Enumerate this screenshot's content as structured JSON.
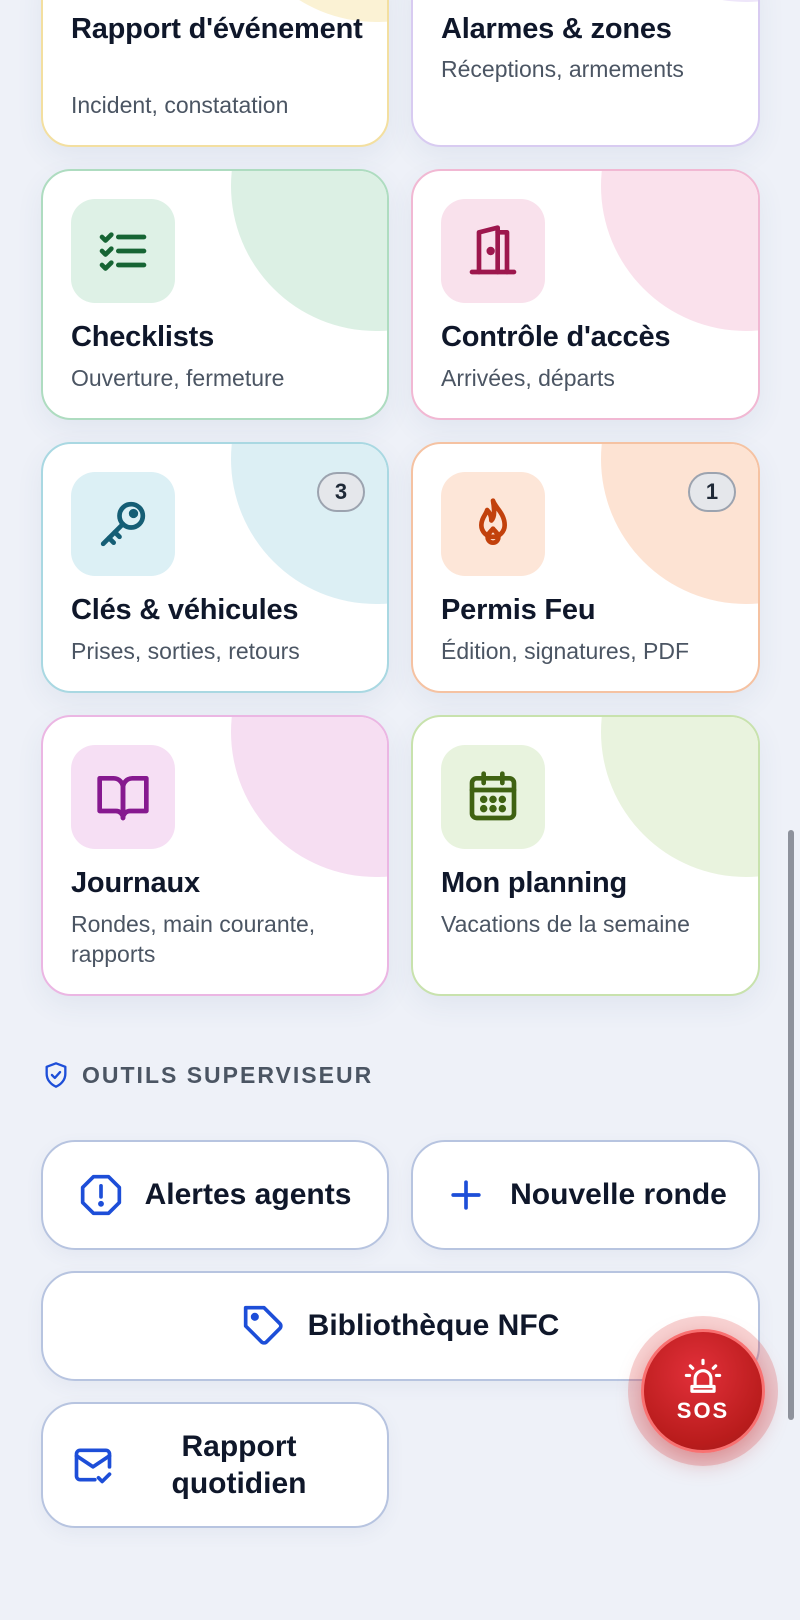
{
  "cards": {
    "rapport": {
      "title": "Rapport d'événement",
      "sub": "Incident, constatation"
    },
    "alarmes": {
      "title": "Alarmes & zones",
      "sub": "Réceptions, armements"
    },
    "checklists": {
      "title": "Checklists",
      "sub": "Ouverture, fermeture"
    },
    "controle": {
      "title": "Contrôle d'accès",
      "sub": "Arrivées, départs"
    },
    "cles": {
      "title": "Clés & véhicules",
      "sub": "Prises, sorties, retours",
      "badge": "3"
    },
    "permis": {
      "title": "Permis Feu",
      "sub": "Édition, signatures, PDF",
      "badge": "1"
    },
    "journaux": {
      "title": "Journaux",
      "sub": "Rondes, main courante, rapports"
    },
    "planning": {
      "title": "Mon planning",
      "sub": "Vacations de la semaine"
    }
  },
  "supervisor": {
    "header": "OUTILS SUPERVISEUR",
    "alertes": "Alertes agents",
    "nouvelle_ronde": "Nouvelle ronde",
    "nfc": "Bibliothèque NFC",
    "rapport_quotidien": "Rapport quotidien"
  },
  "sos": {
    "label": "SOS"
  },
  "colors": {
    "yellow": "#f7e7a8",
    "purple": "#ddd0f3",
    "green": "#aedcc0",
    "pink": "#f1b8d3",
    "teal": "#a9d8e2",
    "orange": "#f5c2a2",
    "magenta": "#ebb6e3",
    "lime": "#c8e2ad",
    "sos_red": "#b91c1c",
    "supervisor_blue": "#1d4ed8"
  }
}
